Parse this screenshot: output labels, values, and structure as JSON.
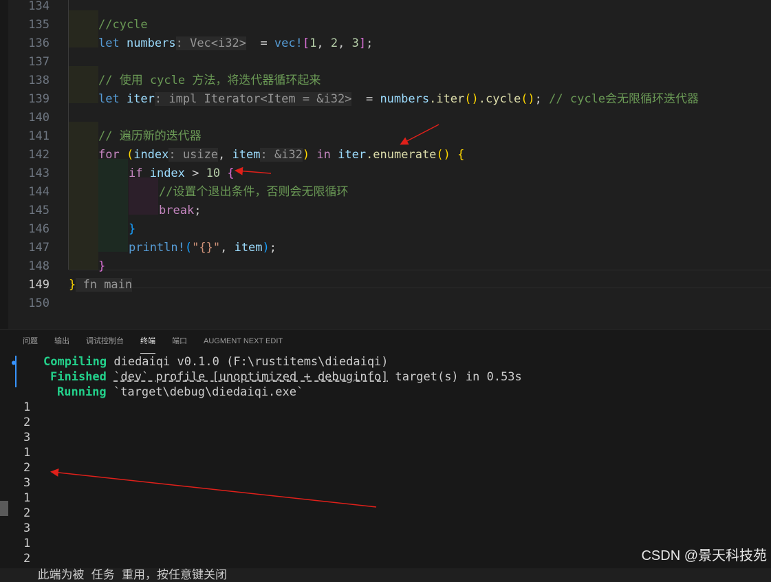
{
  "editor": {
    "lines": [
      {
        "n": "134",
        "parts": []
      },
      {
        "n": "135",
        "parts": [
          [
            "cm",
            "//cycle"
          ]
        ]
      },
      {
        "n": "136",
        "parts": [
          [
            "kw",
            "let "
          ],
          [
            "var",
            "numbers"
          ],
          [
            "hint",
            ": Vec<i32>"
          ],
          [
            "",
            "  = "
          ],
          [
            "mac",
            "vec!"
          ],
          [
            "b2",
            "["
          ],
          [
            "num",
            "1"
          ],
          [
            "",
            ", "
          ],
          [
            "num",
            "2"
          ],
          [
            "",
            ", "
          ],
          [
            "num",
            "3"
          ],
          [
            "b2",
            "]"
          ],
          [
            "",
            ";"
          ]
        ]
      },
      {
        "n": "137",
        "parts": []
      },
      {
        "n": "138",
        "parts": [
          [
            "cm",
            "// 使用 cycle 方法，将迭代器循环起来"
          ]
        ]
      },
      {
        "n": "139",
        "parts": [
          [
            "kw",
            "let "
          ],
          [
            "var",
            "iter"
          ],
          [
            "hint",
            ": impl Iterator<Item = &i32>"
          ],
          [
            "",
            ""
          ],
          [
            "",
            ""
          ],
          [
            "",
            ""
          ],
          [
            "",
            ""
          ],
          [
            "",
            ""
          ],
          [
            "",
            ""
          ],
          [
            "",
            ""
          ],
          [
            "",
            ""
          ]
        ]
      },
      {
        "n": "140",
        "parts": []
      },
      {
        "n": "141",
        "parts": [
          [
            "cm",
            "// 遍历新的迭代器"
          ]
        ]
      },
      {
        "n": "142",
        "parts": []
      },
      {
        "n": "143",
        "parts": []
      },
      {
        "n": "144",
        "parts": [
          [
            "cm",
            "//设置个退出条件，否则会无限循环"
          ]
        ]
      },
      {
        "n": "145",
        "parts": [
          [
            "ctl",
            "break"
          ],
          [
            "",
            ";"
          ]
        ]
      },
      {
        "n": "146",
        "parts": [
          [
            "b3",
            "}"
          ]
        ]
      },
      {
        "n": "147",
        "parts": [
          [
            "mac",
            "println!"
          ],
          [
            "b3",
            "("
          ],
          [
            "str",
            "\"{}\""
          ],
          [
            "",
            ", "
          ],
          [
            "var",
            "item"
          ],
          [
            "b3",
            ")"
          ],
          [
            "",
            ";"
          ]
        ]
      },
      {
        "n": "148",
        "parts": [
          [
            "b2",
            "}"
          ]
        ]
      },
      {
        "n": "149",
        "parts": [
          [
            "b1",
            "}"
          ],
          [
            "hint",
            " fn main"
          ]
        ]
      },
      {
        "n": "150",
        "parts": []
      }
    ],
    "line139_tail": [
      [
        "",
        ""
      ],
      [
        "",
        ""
      ]
    ],
    "line139_rest": [
      [
        "",
        "  = "
      ],
      [
        "var",
        "numbers"
      ],
      [
        "",
        ""
      ],
      [
        "fn",
        ".iter"
      ],
      [
        "b1",
        "()"
      ],
      [
        "fn",
        ".cycle"
      ],
      [
        "b1",
        "()"
      ],
      [
        "",
        ";"
      ],
      [
        "cm",
        " // cycle会无限循环迭代器"
      ]
    ],
    "line142": [
      [
        "ctl",
        "for "
      ],
      [
        "b1",
        "("
      ],
      [
        "var",
        "index"
      ],
      [
        "hint",
        ": usize"
      ],
      [
        "",
        ", "
      ],
      [
        "var",
        "item"
      ],
      [
        "hint",
        ": &i32"
      ],
      [
        "b1",
        ")"
      ],
      [
        "ctl",
        " in "
      ],
      [
        "var",
        "iter"
      ],
      [
        "fn",
        ".enumerate"
      ],
      [
        "b1",
        "()"
      ],
      [
        "b1",
        " {"
      ]
    ],
    "line143": [
      [
        "ctl",
        "if "
      ],
      [
        "var",
        "index"
      ],
      [
        "",
        " > "
      ],
      [
        "num",
        "10"
      ],
      [
        "b2",
        " {"
      ]
    ]
  },
  "panel": {
    "tabs": [
      "问题",
      "输出",
      "调试控制台",
      "终端",
      "端口",
      "AUGMENT NEXT EDIT"
    ],
    "active_tab": "终端"
  },
  "terminal": {
    "compiling_label": "Compiling",
    "compiling_text": " diedaiqi v0.1.0 (F:\\rustitems\\diedaiqi)",
    "finished_label": "Finished",
    "finished_pre": " ",
    "finished_u": "`dev` profile [unoptimized + debuginfo]",
    "finished_post": " target(s) in 0.53s",
    "running_label": "Running",
    "running_text": " `target\\debug\\diedaiqi.exe`",
    "output": [
      "1",
      "2",
      "3",
      "1",
      "2",
      "3",
      "1",
      "2",
      "3",
      "1",
      "2"
    ],
    "bottom_partial": "  此端为被 任务 重用，按任意键关闭"
  },
  "watermark": "CSDN @景天科技苑",
  "colors": {
    "annotation_arrow": "#e0201a",
    "terminal_green": "#23d18b",
    "cursor_blue": "#3794ff"
  }
}
